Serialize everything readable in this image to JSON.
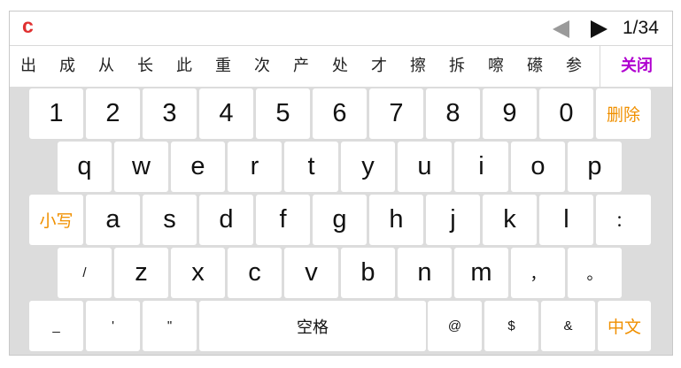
{
  "topbar": {
    "pinyin": "c",
    "page_indicator": "1/34",
    "prev_icon": "triangle-left-icon",
    "next_icon": "triangle-right-icon"
  },
  "candidates": [
    "出",
    "成",
    "从",
    "长",
    "此",
    "重",
    "次",
    "产",
    "处",
    "才",
    "擦",
    "拆",
    "嚓",
    "礤",
    "参"
  ],
  "close_label": "关闭",
  "colors": {
    "pinyin": "#e03030",
    "close": "#b000d0",
    "function_key": "#f09000",
    "keyboard_bg": "#dcdcdc"
  },
  "keys": {
    "row1": [
      "1",
      "2",
      "3",
      "4",
      "5",
      "6",
      "7",
      "8",
      "9",
      "0"
    ],
    "delete": "删除",
    "row2": [
      "q",
      "w",
      "e",
      "r",
      "t",
      "y",
      "u",
      "i",
      "o",
      "p"
    ],
    "lowercase": "小写",
    "row3": [
      "a",
      "s",
      "d",
      "f",
      "g",
      "h",
      "j",
      "k",
      "l"
    ],
    "colon": "：",
    "slash": "/",
    "row4": [
      "z",
      "x",
      "c",
      "v",
      "b",
      "n",
      "m"
    ],
    "comma": "，",
    "period": "。",
    "underscore": "_",
    "apostrophe": "'",
    "quote": "\"",
    "space": "空格",
    "at": "@",
    "dollar": "$",
    "amp": "&",
    "chinese": "中文"
  }
}
